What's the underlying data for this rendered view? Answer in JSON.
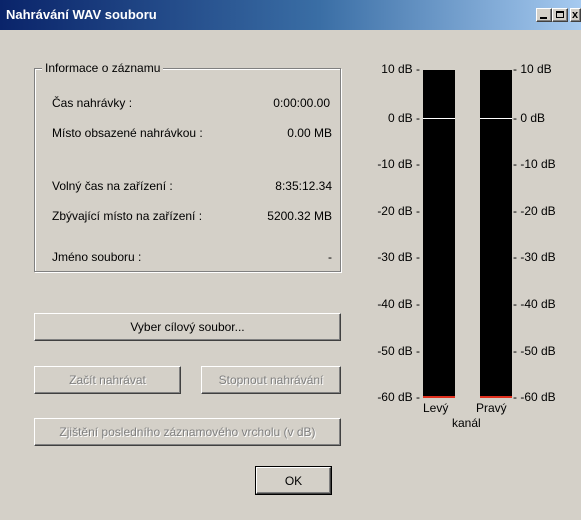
{
  "window": {
    "title": "Nahrávání WAV souboru",
    "controls": {
      "minimize_icon": "minimize-icon",
      "maximize_icon": "maximize-icon",
      "close_glyph": "x"
    }
  },
  "info": {
    "group_title": "Informace o záznamu",
    "rows": [
      {
        "label": "Čas nahrávky :",
        "value": "0:00:00.00"
      },
      {
        "label": "Místo obsazené nahrávkou :",
        "value": "0.00 MB"
      },
      {
        "label": "Volný čas na zařízení :",
        "value": "8:35:12.34"
      },
      {
        "label": "Zbývající místo na zařízení :",
        "value": "5200.32 MB"
      },
      {
        "label": "Jméno souboru :",
        "value": "-"
      }
    ]
  },
  "buttons": {
    "select_file": "Vyber cílový soubor...",
    "start_recording": "Začít nahrávat",
    "stop_recording": "Stopnout nahrávání",
    "peak_check": "Zjištění posledního záznamového vrcholu (v dB)",
    "ok": "OK"
  },
  "meter": {
    "scale_left": [
      "10 dB -",
      "0 dB -",
      "-10 dB -",
      "-20 dB -",
      "-30 dB -",
      "-40 dB -",
      "-50 dB -",
      "-60 dB -"
    ],
    "scale_right": [
      "- 10 dB",
      "- 0 dB",
      "- -10 dB",
      "- -20 dB",
      "- -30 dB",
      "- -40 dB",
      "- -50 dB",
      "- -60 dB"
    ],
    "left_channel": "Levý",
    "right_channel": "Pravý",
    "channel_word": "kanál",
    "colors": {
      "meter_bg": "#000000",
      "zero_line": "#ffffff",
      "base_line": "#e0301e"
    }
  }
}
